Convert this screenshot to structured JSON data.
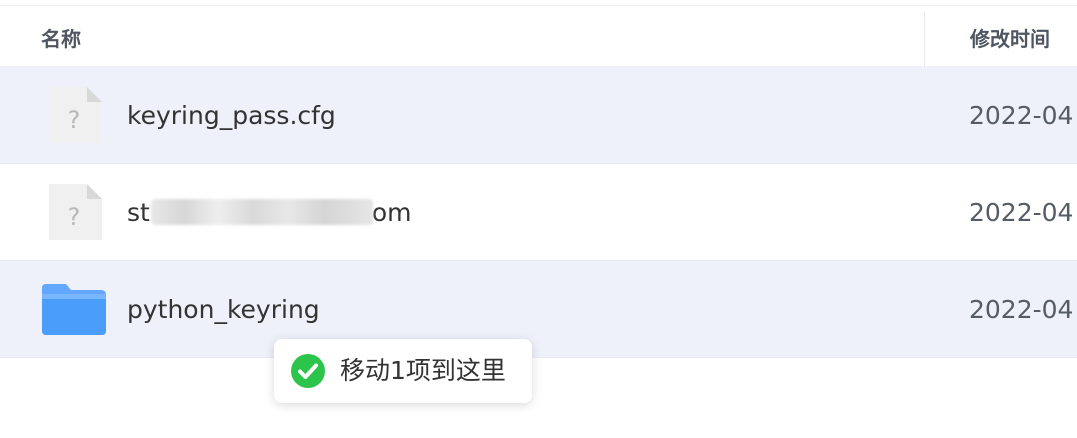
{
  "header": {
    "name_label": "名称",
    "modified_label": "修改时间"
  },
  "files": [
    {
      "name": "keyring_pass.cfg",
      "modified": "2022-04",
      "icon": "unknown-file-icon",
      "selected": true
    },
    {
      "name_prefix": "st",
      "name_suffix": "om",
      "modified": "2022-04",
      "icon": "unknown-file-icon",
      "selected": false
    },
    {
      "name": "python_keyring",
      "modified": "2022-04",
      "icon": "folder-icon",
      "selected": true
    }
  ],
  "toast": {
    "message": "移动1项到这里",
    "icon": "success-check-icon"
  },
  "colors": {
    "selected_row_bg": "#eef0fa",
    "folder_blue": "#4b9dfb",
    "success_green": "#2cc44b"
  }
}
